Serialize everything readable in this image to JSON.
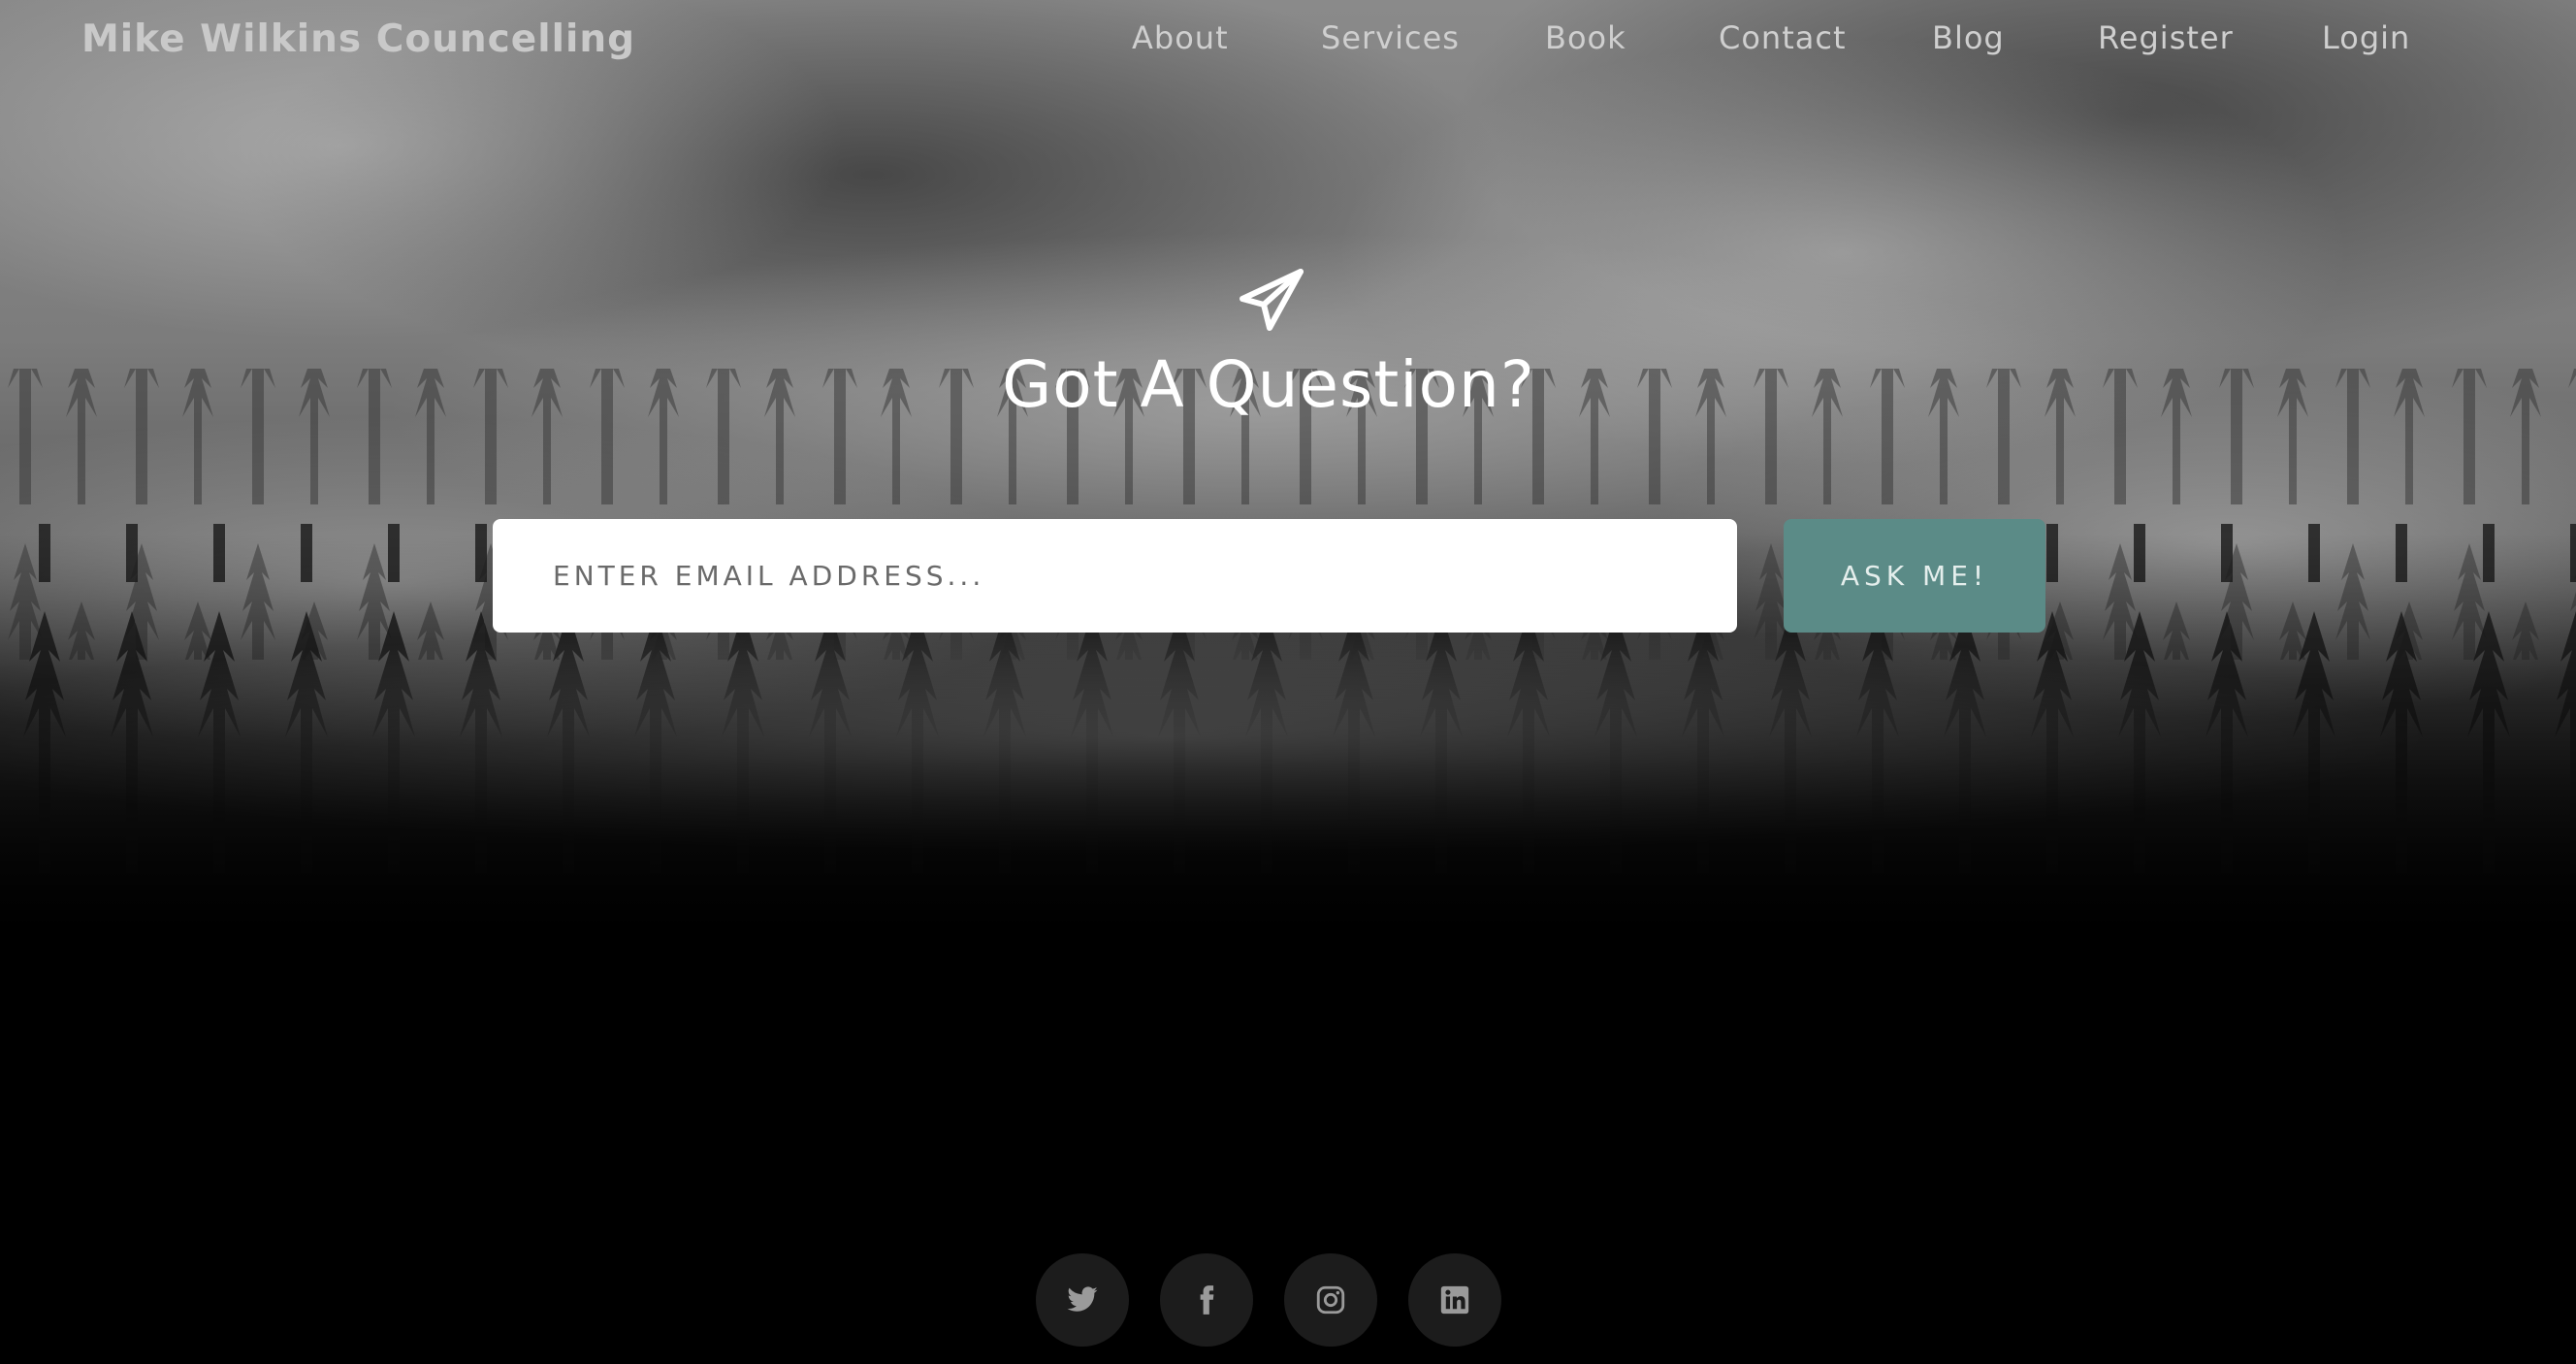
{
  "brand": {
    "name": "Mike Wilkins Councelling"
  },
  "nav": {
    "items": [
      {
        "label": "About"
      },
      {
        "label": "Services"
      },
      {
        "label": "Book"
      },
      {
        "label": "Contact"
      },
      {
        "label": "Blog"
      },
      {
        "label": "Register"
      },
      {
        "label": "Login"
      }
    ]
  },
  "hero": {
    "icon": "paper-plane-icon",
    "title": "Got A Question?",
    "email_placeholder": "ENTER EMAIL ADDRESS...",
    "email_value": "",
    "button_label": "ASK ME!"
  },
  "social": {
    "icons": [
      "twitter-icon",
      "facebook-icon",
      "instagram-icon",
      "linkedin-icon"
    ]
  },
  "colors": {
    "accent": "#5b8b87",
    "background": "#000000",
    "nav_text": "#cfcfcf",
    "social_bg": "#1c1c1c"
  }
}
